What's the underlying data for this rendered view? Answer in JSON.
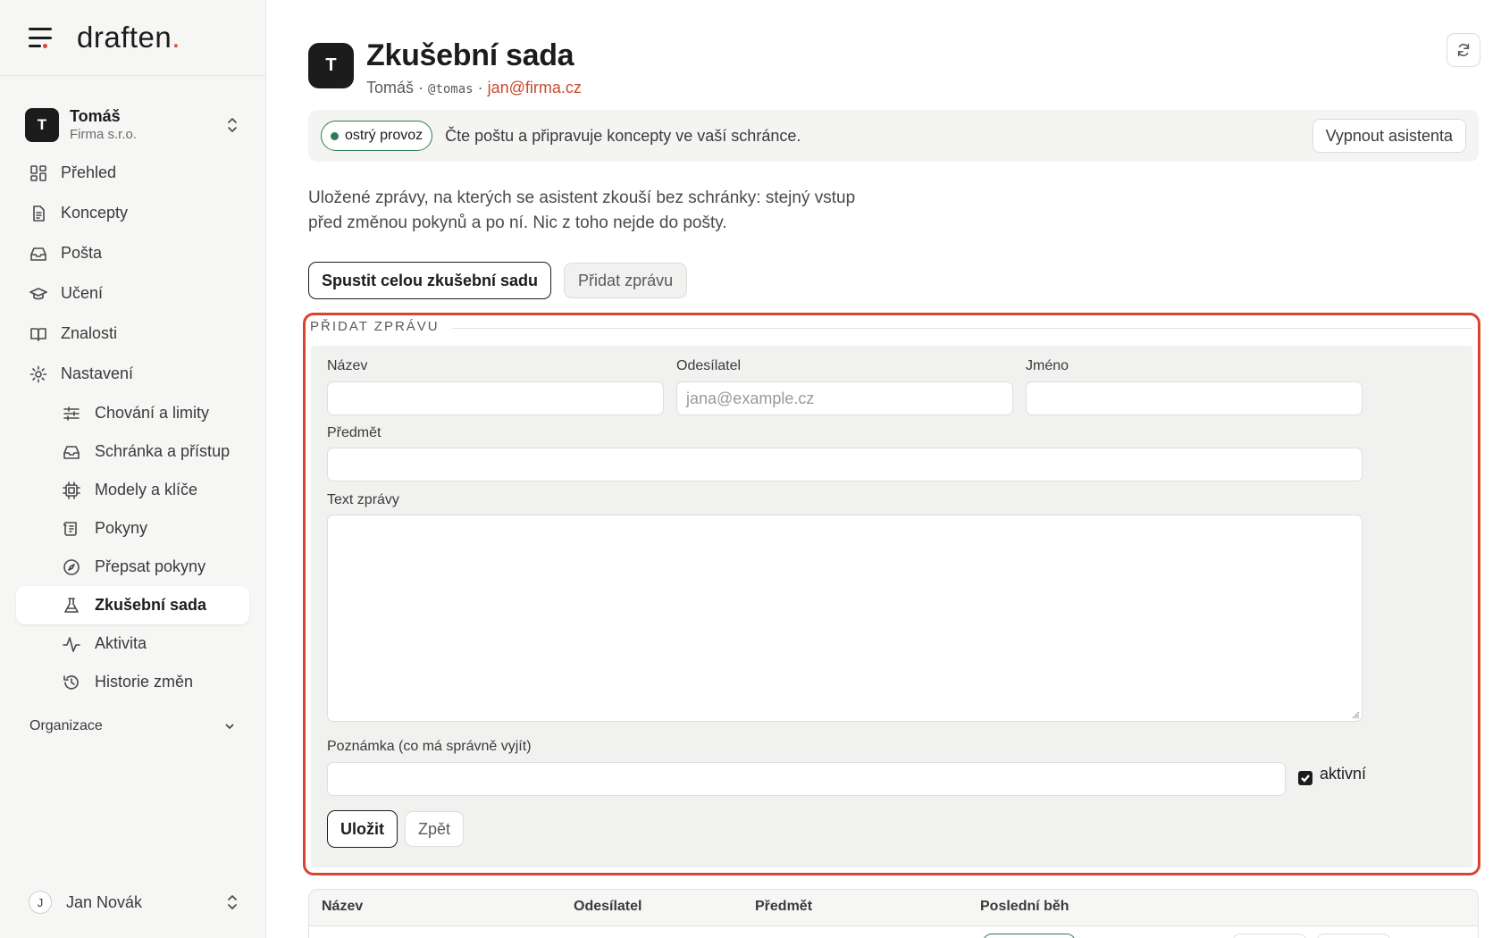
{
  "app": {
    "brand_name": "draften",
    "brand_dot": ".",
    "accent_color": "#d14a36"
  },
  "account": {
    "initial": "T",
    "name": "Tomáš",
    "org": "Firma s.r.o."
  },
  "nav": {
    "items": [
      {
        "label": "Přehled",
        "icon": "grid-icon"
      },
      {
        "label": "Koncepty",
        "icon": "document-icon"
      },
      {
        "label": "Pošta",
        "icon": "inbox-icon"
      },
      {
        "label": "Učení",
        "icon": "graduation-cap-icon"
      },
      {
        "label": "Znalosti",
        "icon": "book-icon"
      },
      {
        "label": "Nastavení",
        "icon": "gear-icon"
      }
    ],
    "sub_items": [
      {
        "label": "Chování a limity",
        "icon": "sliders-icon"
      },
      {
        "label": "Schránka a přístup",
        "icon": "inbox-icon"
      },
      {
        "label": "Modely a klíče",
        "icon": "chip-icon"
      },
      {
        "label": "Pokyny",
        "icon": "scroll-icon"
      },
      {
        "label": "Přepsat pokyny",
        "icon": "compass-icon"
      },
      {
        "label": "Zkušební sada",
        "icon": "flask-icon",
        "active": true
      },
      {
        "label": "Aktivita",
        "icon": "activity-icon"
      },
      {
        "label": "Historie změn",
        "icon": "history-icon"
      }
    ],
    "section": "Organizace"
  },
  "user": {
    "initial": "J",
    "name": "Jan Novák"
  },
  "header": {
    "avatar_initial": "T",
    "title": "Zkušební sada",
    "owner": "Tomáš",
    "sep1": " · ",
    "handle": "@tomas",
    "sep2": " · ",
    "email": "jan@firma.cz"
  },
  "status": {
    "badge": "ostrý provoz",
    "badge_color": "#2f7d54",
    "text": "Čte poštu a připravuje koncepty ve vaší schránce.",
    "button": "Vypnout asistenta"
  },
  "description": "Uložené zprávy, na kterých se asistent zkouší bez schránky: stejný vstup před změnou pokynů a po ní. Nic z toho nejde do pošty.",
  "actions": {
    "run_all": "Spustit celou zkušební sadu",
    "add_message": "Přidat zprávu"
  },
  "form": {
    "legend": "PŘIDAT ZPRÁVU",
    "name_label": "Název",
    "name_value": "",
    "sender_label": "Odesílatel",
    "sender_placeholder": "jana@example.cz",
    "person_label": "Jméno",
    "person_value": "",
    "subject_label": "Předmět",
    "subject_value": "",
    "body_label": "Text zprávy",
    "body_value": "",
    "note_label": "Poznámka (co má správně vyjít)",
    "note_value": "",
    "active_label": "aktivní",
    "active_checked": true,
    "save_button": "Uložit",
    "back_button": "Zpět"
  },
  "table": {
    "columns": [
      "Název",
      "Odesílatel",
      "Předmět",
      "Poslední běh"
    ]
  }
}
